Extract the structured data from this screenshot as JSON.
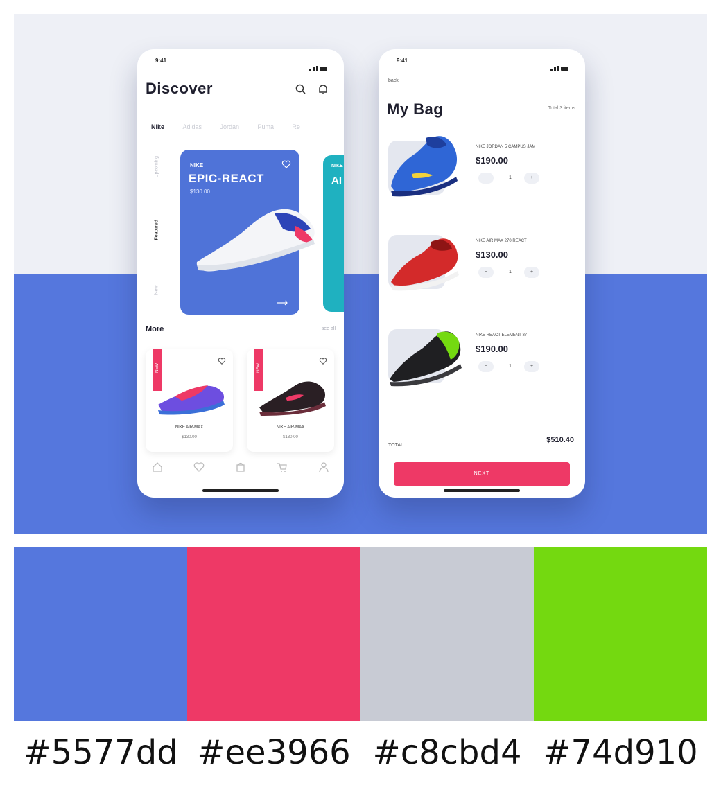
{
  "left_phone": {
    "time": "9:41",
    "title": "Discover",
    "brand_tabs": [
      "Nike",
      "Adidas",
      "Jordan",
      "Puma",
      "Re"
    ],
    "side_categories": [
      "Upcoming",
      "Featured",
      "New"
    ],
    "hero": {
      "brand": "NIKE",
      "name": "EPIC-REACT",
      "price": "$130.00"
    },
    "teal_card": {
      "brand": "NIKE",
      "name": "AI"
    },
    "more": {
      "title": "More",
      "link": "see all"
    },
    "products": [
      {
        "tag": "NEW",
        "name": "NIKE AIR-MAX",
        "price": "$130.00"
      },
      {
        "tag": "NEW",
        "name": "NIKE AIR-MAX",
        "price": "$130.00"
      }
    ],
    "tab_icons": [
      "home-icon",
      "heart-icon",
      "bag-icon",
      "cart-icon",
      "profile-icon"
    ]
  },
  "right_phone": {
    "time": "9:41",
    "back": "back",
    "title": "My Bag",
    "count": "Total 3 items",
    "items": [
      {
        "name": "NIKE JORDAN 5 CAMPUS JAM",
        "price": "$190.00",
        "minus": "−",
        "qty": "1",
        "plus": "+",
        "color": "#2f66d6"
      },
      {
        "name": "NIKE AIR MAX 270 REACT",
        "price": "$130.00",
        "minus": "−",
        "qty": "1",
        "plus": "+",
        "color": "#d32a2a"
      },
      {
        "name": "NIKE REACT ELEMENT 87",
        "price": "$190.00",
        "minus": "−",
        "qty": "1",
        "plus": "+",
        "color": "#74d910"
      }
    ],
    "total_label": "TOTAL",
    "total_value": "$510.40",
    "next_label": "NEXT"
  },
  "palette": [
    {
      "hex": "#5577dd",
      "color": "#5577dd"
    },
    {
      "hex": "#ee3966",
      "color": "#ee3966"
    },
    {
      "hex": "#c8cbd4",
      "color": "#c8cbd4"
    },
    {
      "hex": "#74d910",
      "color": "#74d910"
    }
  ]
}
